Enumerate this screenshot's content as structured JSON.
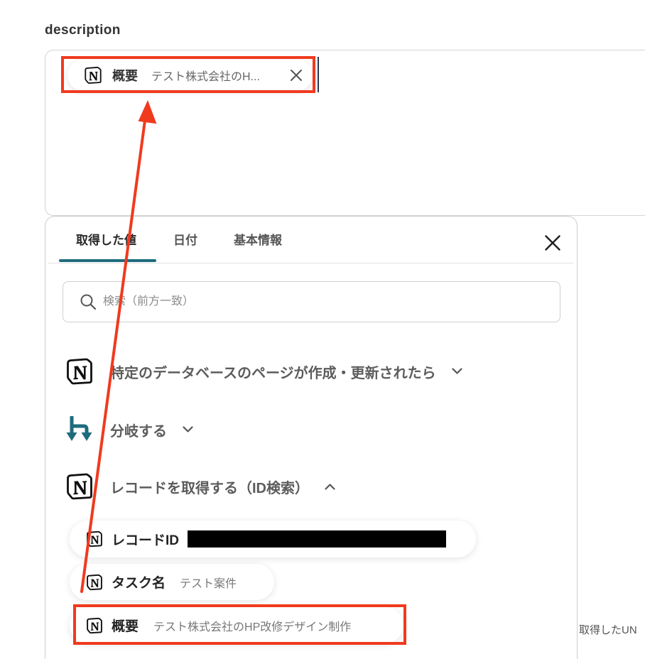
{
  "field": {
    "label": "description",
    "chip": {
      "title": "概要",
      "value": "テスト株式会社のH...",
      "icon": "notion-icon",
      "highlighted": true
    }
  },
  "panel": {
    "tabs": [
      {
        "label": "取得した値",
        "active": true
      },
      {
        "label": "日付",
        "active": false
      },
      {
        "label": "基本情報",
        "active": false
      }
    ],
    "search": {
      "placeholder": "検索（前方一致）"
    },
    "sections": [
      {
        "label": "特定のデータベースのページが作成・更新されたら",
        "icon": "notion-icon",
        "expanded": false
      },
      {
        "label": "分岐する",
        "icon": "branch-icon",
        "expanded": false
      },
      {
        "label": "レコードを取得する（ID検索）",
        "icon": "notion-icon",
        "expanded": true
      }
    ],
    "items": [
      {
        "title": "レコードID",
        "icon": "notion-icon",
        "value_redacted": true
      },
      {
        "title": "タスク名",
        "icon": "notion-icon",
        "value": "テスト案件"
      },
      {
        "title": "概要",
        "icon": "notion-icon",
        "value": "テスト株式会社のHP改修デザイン制作",
        "highlighted": true
      }
    ]
  },
  "side_text": "取得したUN",
  "colors": {
    "accent": "#1f6b7e",
    "annotation": "#f03a1e",
    "redaction": "#000000"
  }
}
